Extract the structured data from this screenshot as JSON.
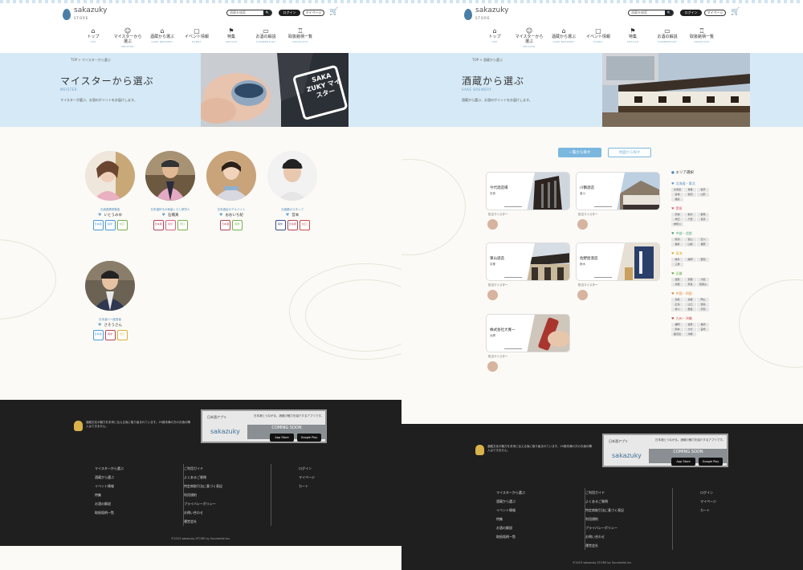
{
  "header": {
    "logo": "sakazuky",
    "logo_sub": "STORE",
    "search_placeholder": "酒蔵を検索",
    "search_btn": "🔍",
    "login": "ログイン",
    "mypage": "マイページ",
    "cart": "🛒",
    "nav": [
      {
        "label": "トップ",
        "en": "TOP",
        "icon": "⌂"
      },
      {
        "label": "マイスターから選ぶ",
        "en": "MEISTER",
        "icon": "☺"
      },
      {
        "label": "酒蔵から選ぶ",
        "en": "SAKE BREWERY",
        "icon": "⌂"
      },
      {
        "label": "イベント情報",
        "en": "EVENT",
        "icon": "▢"
      },
      {
        "label": "特集",
        "en": "ARTICLE",
        "icon": "⚑"
      },
      {
        "label": "お酒の解説",
        "en": "COMMENTARY",
        "icon": "▭"
      },
      {
        "label": "取扱銘柄一覧",
        "en": "PRODUCTS",
        "icon": "♖"
      }
    ]
  },
  "left": {
    "crumb_home": "TOP",
    "crumb_sep": " > ",
    "crumb_current": "マイスターから選ぶ",
    "title": "マイスターから選ぶ",
    "subtitle": "MEISTER",
    "desc": "マイスターが選ぶ、お酒のポイントをお届けします。",
    "hero_stamp": "SAKA ZUKY マイスター",
    "meisters": [
      {
        "role": "元酒造業勤務者",
        "name": "いとうみゆ",
        "badges": [
          "日本酒",
          "純米",
          "甘口"
        ]
      },
      {
        "role": "日本酒好きの和装くらし研究人",
        "name": "石橋真",
        "badges": [
          "日本酒",
          "純米",
          "辛口"
        ]
      },
      {
        "role": "日本酒店のアルバイト",
        "name": "おおいち紀",
        "badges": [
          "日本酒",
          "純米"
        ]
      },
      {
        "role": "元酒蔵のスタッフ",
        "name": "宮本",
        "badges": [
          "純米",
          "日本酒",
          "甘口"
        ]
      },
      {
        "role": "日本酒バー経営者",
        "name": "さそうさん",
        "badges": [
          "日本酒",
          "純米",
          "甘口"
        ]
      }
    ]
  },
  "right": {
    "crumb_home": "TOP",
    "crumb_sep": " > ",
    "crumb_current": "酒蔵から選ぶ",
    "title": "酒蔵から選ぶ",
    "subtitle": "SAKE BREWERY",
    "desc": "酒蔵から選ぶ、お酒のポイントをお届けします。",
    "tab_list": "一覧から探す",
    "tab_area": "地図から探す",
    "breweries": [
      {
        "name": "今代酒造場",
        "loc": "奈良",
        "meister": "担当マイスター"
      },
      {
        "name": "川鶴酒造",
        "loc": "香川",
        "meister": "担当マイスター"
      },
      {
        "name": "東山酒造",
        "loc": "京都",
        "meister": "担当マイスター"
      },
      {
        "name": "佐野屋酒造",
        "loc": "栃木",
        "meister": "担当マイスター"
      },
      {
        "name": "株式会社大寛一",
        "loc": "兵庫",
        "meister": "担当マイスター"
      }
    ],
    "area_heading": "エリア選択",
    "regions": [
      {
        "name": "北海道・東北",
        "color": "#5a8fc8",
        "prefs": [
          "北海道",
          "青森",
          "岩手",
          "宮城",
          "秋田",
          "山形",
          "福島"
        ]
      },
      {
        "name": "関東",
        "color": "#e0607e",
        "prefs": [
          "茨城",
          "栃木",
          "群馬",
          "埼玉",
          "千葉",
          "東京",
          "神奈川"
        ]
      },
      {
        "name": "中部・北陸",
        "color": "#4aa07a",
        "prefs": [
          "新潟",
          "富山",
          "石川",
          "福井",
          "山梨",
          "長野"
        ]
      },
      {
        "name": "東海",
        "color": "#d9b030",
        "prefs": [
          "岐阜",
          "静岡",
          "愛知",
          "三重"
        ]
      },
      {
        "name": "近畿",
        "color": "#6ab04c",
        "prefs": [
          "滋賀",
          "京都",
          "大阪",
          "兵庫",
          "奈良",
          "和歌山"
        ]
      },
      {
        "name": "中国・四国",
        "color": "#e08840",
        "prefs": [
          "鳥取",
          "島根",
          "岡山",
          "広島",
          "山口",
          "徳島",
          "香川",
          "愛媛",
          "高知"
        ]
      },
      {
        "name": "九州・沖縄",
        "color": "#d04848",
        "prefs": [
          "福岡",
          "佐賀",
          "長崎",
          "熊本",
          "大分",
          "宮崎",
          "鹿児島",
          "沖縄"
        ]
      }
    ]
  },
  "footer": {
    "notice": "酒蔵文化の魅力を未来に伝える為に取り組まれています。20歳未満の方のお酒の購入はできません。",
    "app_label": "日本酒アプリ",
    "app_note": "日本酒とつながる。酒蔵の魅力を紹介するアプリです。",
    "app_name": "sakazuky",
    "coming": "COMING SOON",
    "appstore": "App Store",
    "googleplay": "Google Play",
    "col1": [
      "マイスターから選ぶ",
      "酒蔵から選ぶ",
      "イベント情報",
      "特集",
      "お酒の解説",
      "取扱銘柄一覧"
    ],
    "col2": [
      "ご利用ガイド",
      "よくあるご質問",
      "特定商取引法に基づく表記",
      "利用規約",
      "プライバシーポリシー",
      "お問い合わせ",
      "運営会社"
    ],
    "col3": [
      "ログイン",
      "マイページ",
      "カート"
    ],
    "copyright": "©2023 sakazuky STORE by Succeedia Inc."
  }
}
